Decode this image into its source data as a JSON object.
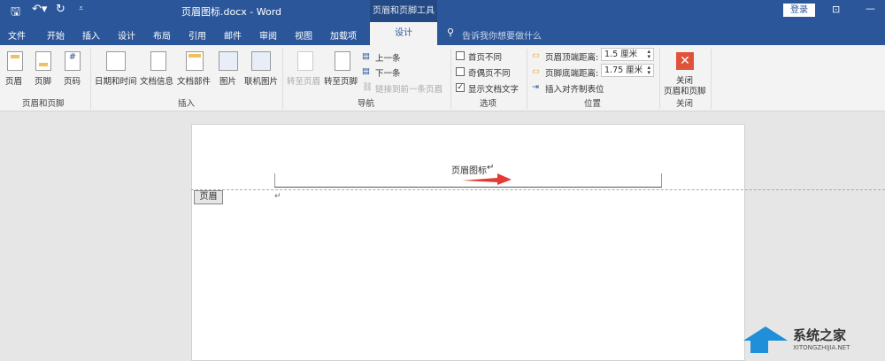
{
  "title": "页眉图标.docx  -  Word",
  "contextual_tab": "页眉和页脚工具",
  "login": "登录",
  "qat": {
    "save": "save-icon",
    "undo": "undo-icon",
    "redo": "redo-icon"
  },
  "tabs": [
    "文件",
    "开始",
    "插入",
    "设计",
    "布局",
    "引用",
    "邮件",
    "审阅",
    "视图",
    "加载项"
  ],
  "active_tab": "设计",
  "tell_me": "告诉我你想要做什么",
  "groups": {
    "hf": {
      "label": "页眉和页脚",
      "buttons": [
        "页眉",
        "页脚",
        "页码"
      ]
    },
    "insert": {
      "label": "插入",
      "buttons": [
        "日期和时间",
        "文档信息",
        "文档部件",
        "图片",
        "联机图片"
      ]
    },
    "nav": {
      "label": "导航",
      "goto_header": "转至页眉",
      "goto_footer": "转至页脚",
      "prev": "上一条",
      "next": "下一条",
      "link": "链接到前一条页眉"
    },
    "options": {
      "label": "选项",
      "first": "首页不同",
      "odd_even": "奇偶页不同",
      "show_text": "显示文档文字",
      "show_text_checked": true
    },
    "position": {
      "label": "位置",
      "header_top": "页眉顶端距离:",
      "header_top_value": "1.5 厘米",
      "footer_bottom": "页脚底端距离:",
      "footer_bottom_value": "1.75 厘米",
      "insert_tab": "插入对齐制表位"
    },
    "close": {
      "label": "关闭",
      "button": "关闭\n页眉和页脚",
      "line1": "关闭",
      "line2": "页眉和页脚"
    }
  },
  "document": {
    "header_text": "页眉图标",
    "header_tag": "页眉",
    "para_mark": "↵"
  },
  "colors": {
    "brand": "#2b579a",
    "close": "#e0523a",
    "arrow": "#e53935"
  }
}
